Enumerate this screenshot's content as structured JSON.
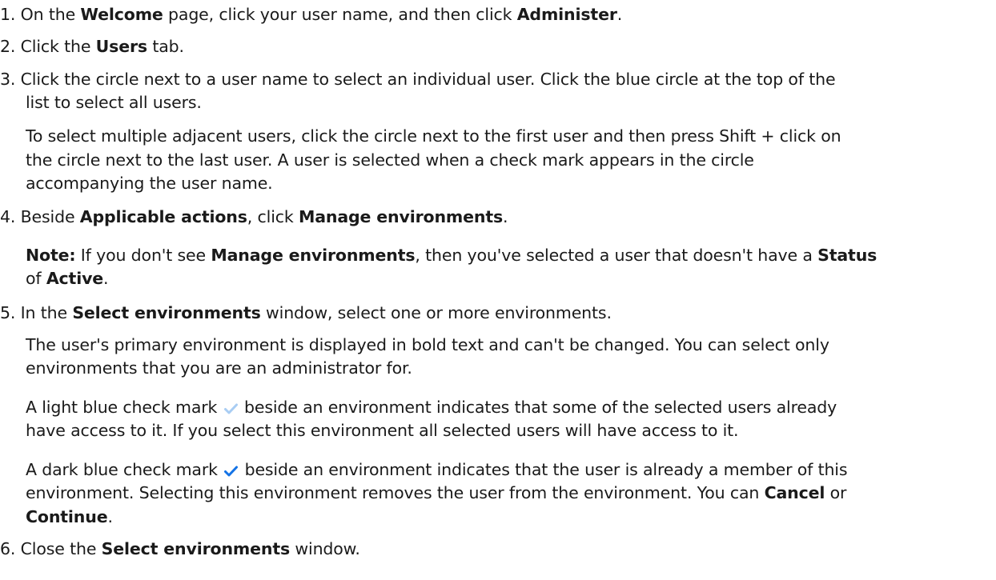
{
  "steps": [
    {
      "number": "1.",
      "parts": [
        "On the ",
        "Welcome",
        " page, click your user name, and then click ",
        "Administer",
        "."
      ]
    },
    {
      "number": "2.",
      "parts": [
        "Click the ",
        "Users",
        " tab."
      ]
    },
    {
      "number": "3.",
      "lines": [
        "Click the circle next to a user name to select an individual user. Click the blue circle at the top of the",
        "list to select all users."
      ],
      "detail_lines": [
        "To select multiple adjacent users, click the circle next to the first user and then press Shift + click on",
        "the circle next to the last user. A user is selected when a check mark appears in the circle",
        "accompanying the user name."
      ]
    },
    {
      "number": "4.",
      "parts": [
        "Beside ",
        "Applicable actions",
        ", click ",
        "Manage environments",
        "."
      ],
      "note": {
        "label": "Note:",
        "line1": [
          " If you don't see ",
          "Manage environments",
          ", then you've selected a user that doesn't have a ",
          "Status"
        ],
        "line2": [
          "of ",
          "Active",
          "."
        ]
      }
    },
    {
      "number": "5.",
      "parts": [
        "In the ",
        "Select environments",
        " window, select one or more environments."
      ],
      "para1_lines": [
        "The user's primary environment is displayed in bold text and can't be changed. You can select only",
        "environments that you are an administrator for."
      ],
      "para2": {
        "line1_before": "A light blue check mark",
        "line1_after": "beside an environment indicates that some of the selected users already",
        "line2": "have access to it. If you select this environment all selected users will have access to it."
      },
      "para3": {
        "line1_before": "A dark blue check mark",
        "line1_after": "beside an environment indicates that the user is already a member of this",
        "line2_parts": [
          "environment. Selecting this environment removes the user from the environment. You can ",
          "Cancel",
          " or"
        ],
        "line3_parts": [
          "Continue",
          "."
        ]
      }
    },
    {
      "number": "6.",
      "parts": [
        "Close the ",
        "Select environments",
        " window."
      ]
    }
  ],
  "icons": {
    "light_check": "light-blue-check-icon",
    "dark_check": "dark-blue-check-icon"
  },
  "colors": {
    "text": "#1a1a1a",
    "light_check": "#a9cdf3",
    "dark_check": "#1473e6"
  }
}
